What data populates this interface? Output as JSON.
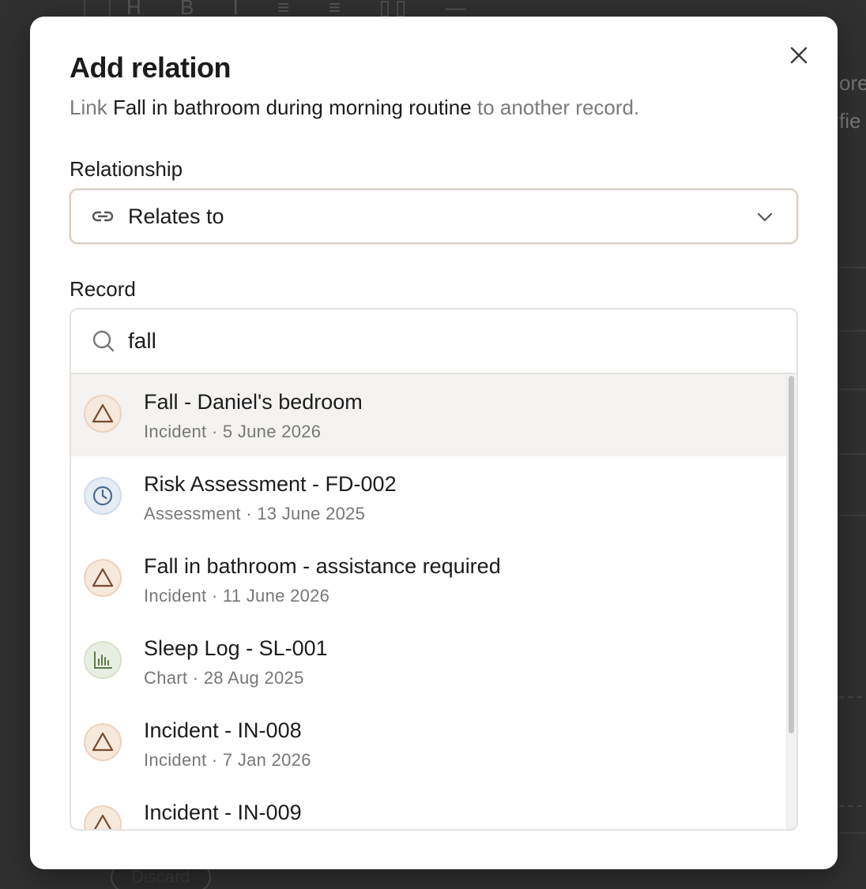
{
  "background": {
    "toolbar_glyphs": [
      "H",
      "B",
      "I",
      "≡",
      "≡",
      "▯▯",
      "—"
    ],
    "right_fragments": [
      "ore",
      "fie"
    ],
    "discard_label": "Discard"
  },
  "modal": {
    "title": "Add relation",
    "subtitle_prefix": "Link",
    "subtitle_record": "Fall in bathroom during morning routine",
    "subtitle_suffix": "to another record.",
    "close_icon": "close-icon"
  },
  "relationship": {
    "label": "Relationship",
    "icon": "link-icon",
    "value": "Relates to"
  },
  "record": {
    "label": "Record",
    "search_value": "fall",
    "results": [
      {
        "name": "Fall - Daniel's bedroom",
        "meta": "Incident · 5 June 2026",
        "kind": "incident",
        "icon": "warning-triangle-icon"
      },
      {
        "name": "Risk Assessment - FD-002",
        "meta": "Assessment · 13 June 2025",
        "kind": "assessment",
        "icon": "clock-icon"
      },
      {
        "name": "Fall in bathroom - assistance required",
        "meta": "Incident · 11 June 2026",
        "kind": "incident",
        "icon": "warning-triangle-icon"
      },
      {
        "name": "Sleep Log - SL-001",
        "meta": "Chart · 28 Aug 2025",
        "kind": "chart",
        "icon": "bar-chart-icon"
      },
      {
        "name": "Incident - IN-008",
        "meta": "Incident · 7 Jan 2026",
        "kind": "incident",
        "icon": "warning-triangle-icon"
      },
      {
        "name": "Incident - IN-009",
        "meta": "",
        "kind": "incident",
        "icon": "warning-triangle-icon"
      }
    ],
    "scroll_fraction_visible": 0.79
  },
  "colors": {
    "incident_icon": "#7a4a2e",
    "assessment_icon": "#4a6a93",
    "chart_icon": "#5f7a4a"
  }
}
